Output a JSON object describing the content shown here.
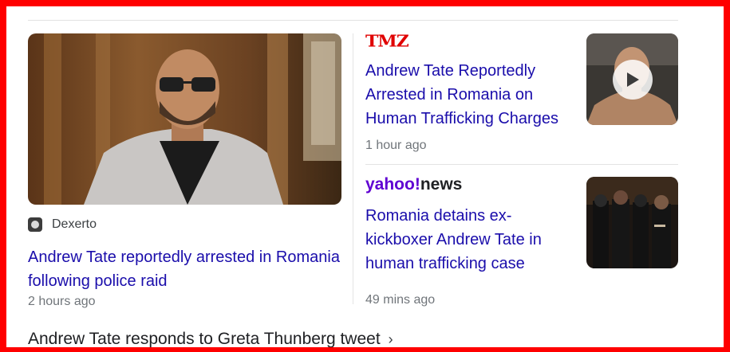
{
  "main_story": {
    "source": "Dexerto",
    "headline": "Andrew Tate reportedly arrested in Romania following police raid",
    "time": "2 hours ago"
  },
  "side_stories": [
    {
      "source_logo": "TMZ",
      "headline": "Andrew Tate Reportedly Arrested in Romania on Human Trafficking Charges",
      "time": "1 hour ago",
      "has_video": true
    },
    {
      "source_logo_parts": [
        "yahoo!",
        "news"
      ],
      "headline": "Romania detains ex-kickboxer Andrew Tate in human trafficking case",
      "time": "49 mins ago",
      "has_video": false
    }
  ],
  "more_link": {
    "label": "Andrew Tate responds to Greta Thunberg tweet",
    "icon": "chevron-right-icon"
  },
  "colors": {
    "headline_link": "#1a0dab",
    "meta_text": "#70757a",
    "frame": "#ff0000",
    "tmz_red": "#e00000",
    "yahoo_purple": "#6001d2"
  }
}
